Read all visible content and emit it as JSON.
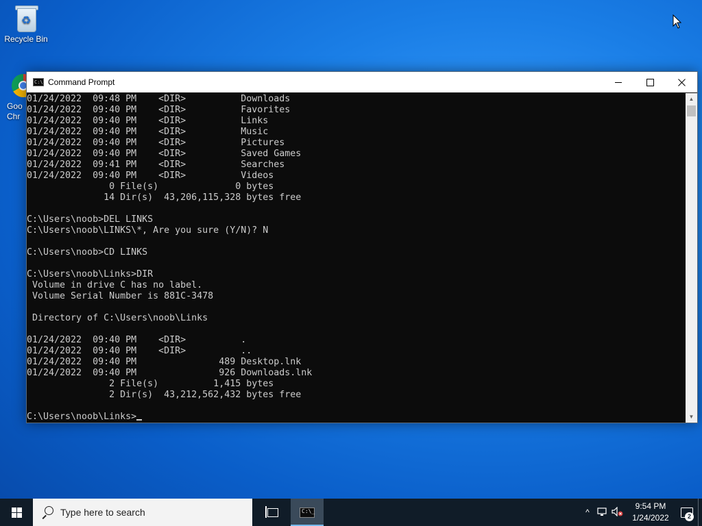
{
  "desktop": {
    "recycle_bin_label": "Recycle Bin",
    "chrome_label_line1": "Goo",
    "chrome_label_line2": "Chr"
  },
  "window": {
    "title": "Command Prompt",
    "icon": "cmd-icon",
    "controls": [
      "minimize",
      "maximize",
      "close"
    ],
    "console_lines": [
      "01/24/2022  09:48 PM    <DIR>          Downloads",
      "01/24/2022  09:40 PM    <DIR>          Favorites",
      "01/24/2022  09:40 PM    <DIR>          Links",
      "01/24/2022  09:40 PM    <DIR>          Music",
      "01/24/2022  09:40 PM    <DIR>          Pictures",
      "01/24/2022  09:40 PM    <DIR>          Saved Games",
      "01/24/2022  09:41 PM    <DIR>          Searches",
      "01/24/2022  09:40 PM    <DIR>          Videos",
      "               0 File(s)              0 bytes",
      "              14 Dir(s)  43,206,115,328 bytes free",
      "",
      "C:\\Users\\noob>DEL LINKS",
      "C:\\Users\\noob\\LINKS\\*, Are you sure (Y/N)? N",
      "",
      "C:\\Users\\noob>CD LINKS",
      "",
      "C:\\Users\\noob\\Links>DIR",
      " Volume in drive C has no label.",
      " Volume Serial Number is 881C-3478",
      "",
      " Directory of C:\\Users\\noob\\Links",
      "",
      "01/24/2022  09:40 PM    <DIR>          .",
      "01/24/2022  09:40 PM    <DIR>          ..",
      "01/24/2022  09:40 PM               489 Desktop.lnk",
      "01/24/2022  09:40 PM               926 Downloads.lnk",
      "               2 File(s)          1,415 bytes",
      "               2 Dir(s)  43,212,562,432 bytes free",
      ""
    ],
    "prompt": "C:\\Users\\noob\\Links>"
  },
  "taskbar": {
    "search_placeholder": "Type here to search",
    "clock_time": "9:54 PM",
    "clock_date": "1/24/2022",
    "notification_count": "2",
    "tray_icons": [
      "chevron-up-icon",
      "network-icon",
      "volume-muted-icon"
    ]
  }
}
